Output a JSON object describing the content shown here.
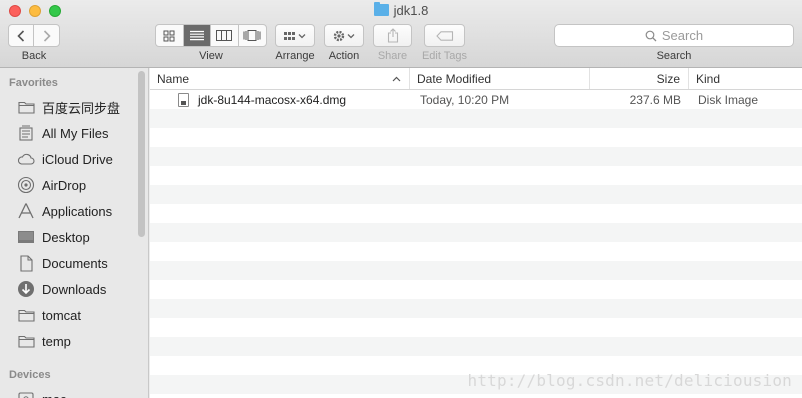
{
  "window": {
    "title": "jdk1.8",
    "colors": {
      "close": "#fc605c",
      "minimize": "#fdbc40",
      "maximize": "#34c84a"
    }
  },
  "toolbar": {
    "back_label": "Back",
    "view_label": "View",
    "arrange_label": "Arrange",
    "action_label": "Action",
    "share_label": "Share",
    "edit_tags_label": "Edit Tags",
    "search_label": "Search",
    "search_placeholder": "Search",
    "view_modes": [
      "icon-view",
      "list-view",
      "column-view",
      "coverflow-view"
    ],
    "active_view": "list-view"
  },
  "sidebar": {
    "favorites_heading": "Favorites",
    "favorites": [
      {
        "label": "百度云同步盘",
        "icon": "folder-icon"
      },
      {
        "label": "All My Files",
        "icon": "all-files-icon"
      },
      {
        "label": "iCloud Drive",
        "icon": "cloud-icon"
      },
      {
        "label": "AirDrop",
        "icon": "airdrop-icon"
      },
      {
        "label": "Applications",
        "icon": "applications-icon"
      },
      {
        "label": "Desktop",
        "icon": "desktop-icon"
      },
      {
        "label": "Documents",
        "icon": "documents-icon"
      },
      {
        "label": "Downloads",
        "icon": "downloads-icon"
      },
      {
        "label": "tomcat",
        "icon": "folder-icon"
      },
      {
        "label": "temp",
        "icon": "folder-icon"
      }
    ],
    "devices_heading": "Devices",
    "devices": [
      {
        "label": "mac",
        "icon": "disk-icon"
      }
    ]
  },
  "columns": {
    "name": "Name",
    "date": "Date Modified",
    "size": "Size",
    "kind": "Kind"
  },
  "files": [
    {
      "name": "jdk-8u144-macosx-x64.dmg",
      "date": "Today, 10:20 PM",
      "size": "237.6 MB",
      "kind": "Disk Image",
      "icon": "dmg-file-icon"
    }
  ],
  "watermark": "http://blog.csdn.net/deliciousion"
}
